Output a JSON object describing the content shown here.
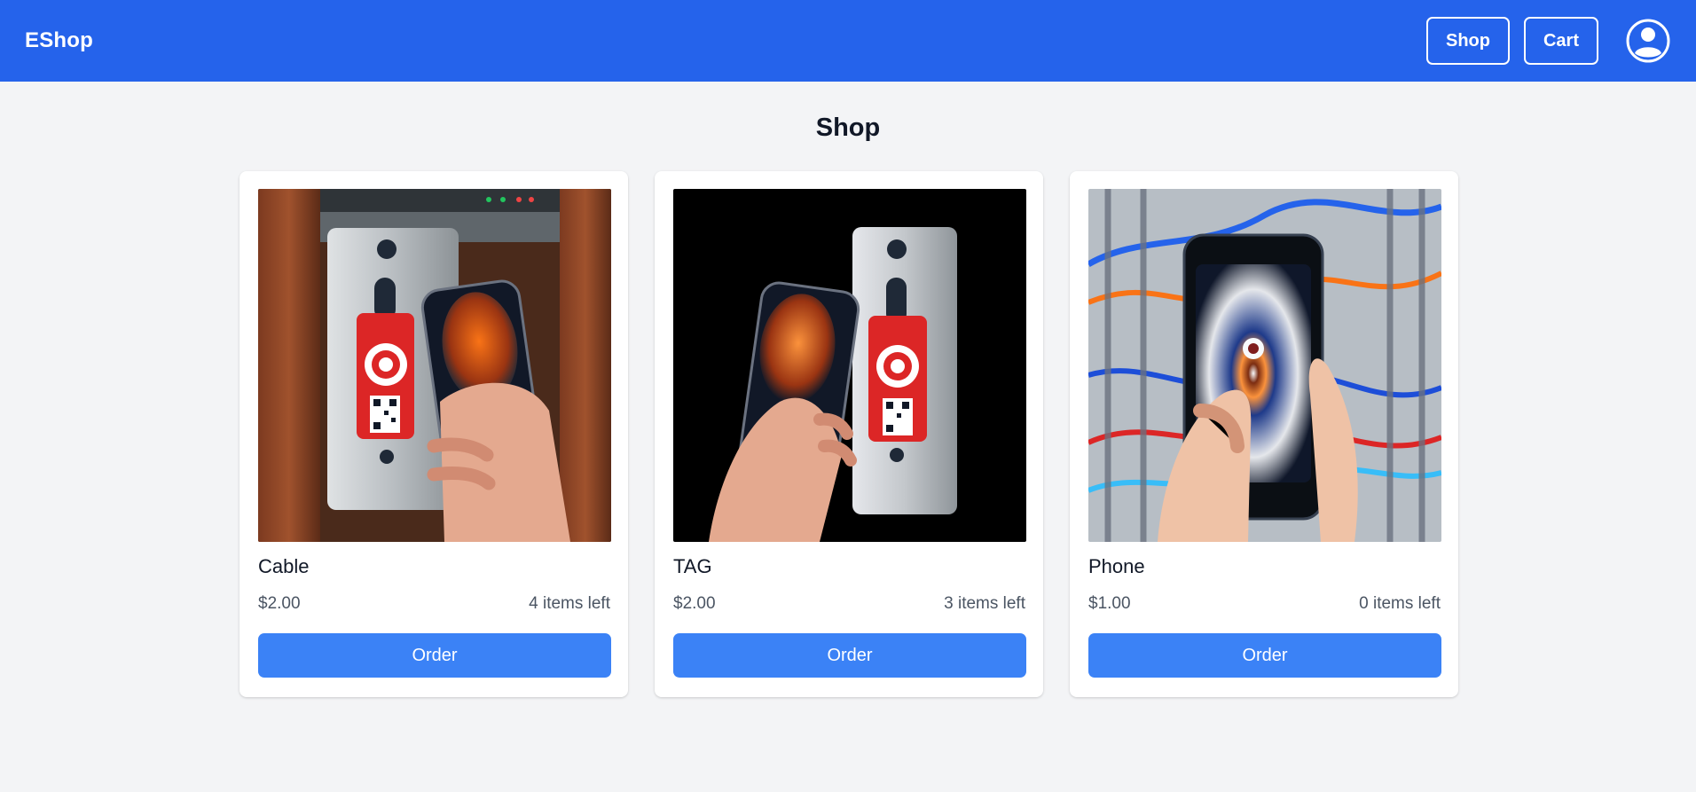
{
  "header": {
    "brand": "EShop",
    "nav": {
      "shop_label": "Shop",
      "cart_label": "Cart"
    },
    "avatar_icon": "user-circle-icon"
  },
  "page": {
    "title": "Shop"
  },
  "products": [
    {
      "name": "Cable",
      "price": "$2.00",
      "stock": "4 items left",
      "button": "Order",
      "image_icon": "phone-fingerprint-tag-image"
    },
    {
      "name": "TAG",
      "price": "$2.00",
      "stock": "3 items left",
      "button": "Order",
      "image_icon": "phone-fingerprint-tag-image"
    },
    {
      "name": "Phone",
      "price": "$1.00",
      "stock": "0 items left",
      "button": "Order",
      "image_icon": "phone-eye-cables-image"
    }
  ],
  "colors": {
    "primary": "#2563eb",
    "button": "#3b82f6",
    "background": "#f3f4f6"
  }
}
